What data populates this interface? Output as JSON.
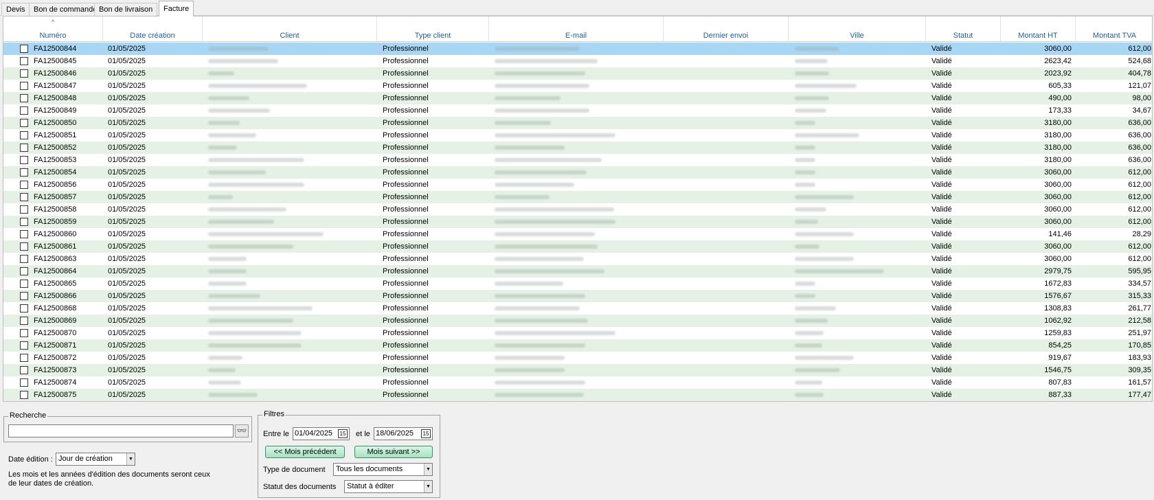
{
  "tabs": [
    "Devis",
    "Bon de commande",
    "Bon de livraison",
    "Facture"
  ],
  "active_tab": "Facture",
  "grid": {
    "sort_indicator": "^",
    "columns": [
      "Numéro",
      "Date création",
      "Client",
      "Type client",
      "E-mail",
      "Dernier envoi",
      "Ville",
      "Statut",
      "Montant HT",
      "Montant TVA"
    ],
    "rows": [
      {
        "numero": "FA12500844",
        "date": "01/05/2025",
        "type": "Professionnel",
        "statut": "Validé",
        "ht": "3060,00",
        "tva": "612,00"
      },
      {
        "numero": "FA12500845",
        "date": "01/05/2025",
        "type": "Professionnel",
        "statut": "Validé",
        "ht": "2623,42",
        "tva": "524,68"
      },
      {
        "numero": "FA12500846",
        "date": "01/05/2025",
        "type": "Professionnel",
        "statut": "Validé",
        "ht": "2023,92",
        "tva": "404,78"
      },
      {
        "numero": "FA12500847",
        "date": "01/05/2025",
        "type": "Professionnel",
        "statut": "Validé",
        "ht": "605,33",
        "tva": "121,07"
      },
      {
        "numero": "FA12500848",
        "date": "01/05/2025",
        "type": "Professionnel",
        "statut": "Validé",
        "ht": "490,00",
        "tva": "98,00"
      },
      {
        "numero": "FA12500849",
        "date": "01/05/2025",
        "type": "Professionnel",
        "statut": "Validé",
        "ht": "173,33",
        "tva": "34,67"
      },
      {
        "numero": "FA12500850",
        "date": "01/05/2025",
        "type": "Professionnel",
        "statut": "Validé",
        "ht": "3180,00",
        "tva": "636,00"
      },
      {
        "numero": "FA12500851",
        "date": "01/05/2025",
        "type": "Professionnel",
        "statut": "Validé",
        "ht": "3180,00",
        "tva": "636,00"
      },
      {
        "numero": "FA12500852",
        "date": "01/05/2025",
        "type": "Professionnel",
        "statut": "Validé",
        "ht": "3180,00",
        "tva": "636,00"
      },
      {
        "numero": "FA12500853",
        "date": "01/05/2025",
        "type": "Professionnel",
        "statut": "Validé",
        "ht": "3180,00",
        "tva": "636,00"
      },
      {
        "numero": "FA12500854",
        "date": "01/05/2025",
        "type": "Professionnel",
        "statut": "Validé",
        "ht": "3060,00",
        "tva": "612,00"
      },
      {
        "numero": "FA12500856",
        "date": "01/05/2025",
        "type": "Professionnel",
        "statut": "Validé",
        "ht": "3060,00",
        "tva": "612,00"
      },
      {
        "numero": "FA12500857",
        "date": "01/05/2025",
        "type": "Professionnel",
        "statut": "Validé",
        "ht": "3060,00",
        "tva": "612,00"
      },
      {
        "numero": "FA12500858",
        "date": "01/05/2025",
        "type": "Professionnel",
        "statut": "Validé",
        "ht": "3060,00",
        "tva": "612,00"
      },
      {
        "numero": "FA12500859",
        "date": "01/05/2025",
        "type": "Professionnel",
        "statut": "Validé",
        "ht": "3060,00",
        "tva": "612,00"
      },
      {
        "numero": "FA12500860",
        "date": "01/05/2025",
        "type": "Professionnel",
        "statut": "Validé",
        "ht": "141,46",
        "tva": "28,29"
      },
      {
        "numero": "FA12500861",
        "date": "01/05/2025",
        "type": "Professionnel",
        "statut": "Validé",
        "ht": "3060,00",
        "tva": "612,00"
      },
      {
        "numero": "FA12500863",
        "date": "01/05/2025",
        "type": "Professionnel",
        "statut": "Validé",
        "ht": "3060,00",
        "tva": "612,00"
      },
      {
        "numero": "FA12500864",
        "date": "01/05/2025",
        "type": "Professionnel",
        "statut": "Validé",
        "ht": "2979,75",
        "tva": "595,95"
      },
      {
        "numero": "FA12500865",
        "date": "01/05/2025",
        "type": "Professionnel",
        "statut": "Validé",
        "ht": "1672,83",
        "tva": "334,57"
      },
      {
        "numero": "FA12500866",
        "date": "01/05/2025",
        "type": "Professionnel",
        "statut": "Validé",
        "ht": "1576,67",
        "tva": "315,33"
      },
      {
        "numero": "FA12500868",
        "date": "01/05/2025",
        "type": "Professionnel",
        "statut": "Validé",
        "ht": "1308,83",
        "tva": "261,77"
      },
      {
        "numero": "FA12500869",
        "date": "01/05/2025",
        "type": "Professionnel",
        "statut": "Validé",
        "ht": "1062,92",
        "tva": "212,58"
      },
      {
        "numero": "FA12500870",
        "date": "01/05/2025",
        "type": "Professionnel",
        "statut": "Validé",
        "ht": "1259,83",
        "tva": "251,97"
      },
      {
        "numero": "FA12500871",
        "date": "01/05/2025",
        "type": "Professionnel",
        "statut": "Validé",
        "ht": "854,25",
        "tva": "170,85"
      },
      {
        "numero": "FA12500872",
        "date": "01/05/2025",
        "type": "Professionnel",
        "statut": "Validé",
        "ht": "919,67",
        "tva": "183,93"
      },
      {
        "numero": "FA12500873",
        "date": "01/05/2025",
        "type": "Professionnel",
        "statut": "Validé",
        "ht": "1546,75",
        "tva": "309,35"
      },
      {
        "numero": "FA12500874",
        "date": "01/05/2025",
        "type": "Professionnel",
        "statut": "Validé",
        "ht": "807,83",
        "tva": "161,57"
      },
      {
        "numero": "FA12500875",
        "date": "01/05/2025",
        "type": "Professionnel",
        "statut": "Validé",
        "ht": "887,33",
        "tva": "177,47"
      }
    ]
  },
  "recherche": {
    "legend": "Recherche",
    "value": ""
  },
  "date_edition": {
    "label": "Date édition :",
    "value": "Jour de création",
    "note_line1": "Les mois et les années d'édition des documents seront ceux",
    "note_line2": "de leur dates de création."
  },
  "filtres": {
    "legend": "Filtres",
    "entre_label": "Entre le",
    "date_from": "01/04/2025",
    "et_label": "et le",
    "date_to": "18/06/2025",
    "prev_btn": "<< Mois précédent",
    "next_btn": "Mois suivant >>",
    "type_label": "Type de document",
    "type_value": "Tous les documents",
    "statut_label": "Statut des documents",
    "statut_value": "Statut à éditer"
  },
  "colors": {
    "row_alt": "#e4f1e4",
    "row_selected": "#a8d7f5",
    "header_text": "#1e5fa8",
    "button": "#a7e2c3"
  }
}
